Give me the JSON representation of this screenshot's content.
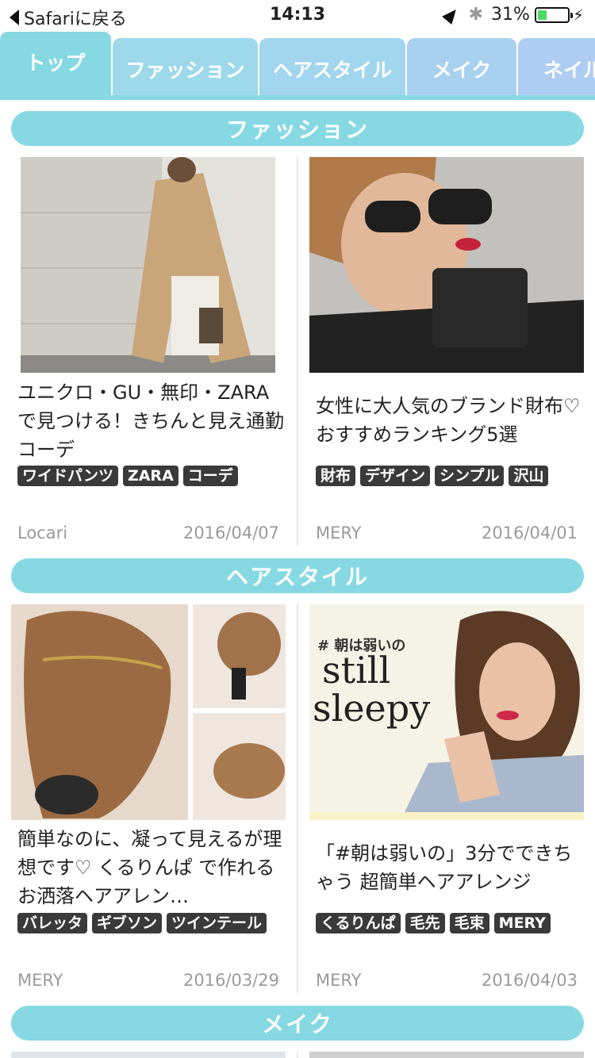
{
  "status_bar": {
    "back_label": "Safariに戻る",
    "time": "14:13",
    "battery_percent": "31%",
    "battery_level": 0.31
  },
  "tabs": [
    {
      "label": "トップ",
      "active": true
    },
    {
      "label": "ファッション"
    },
    {
      "label": "ヘアスタイル"
    },
    {
      "label": "メイク"
    },
    {
      "label": "ネイル"
    }
  ],
  "sections": [
    {
      "title": "ファッション",
      "cards": [
        {
          "title": "ユニクロ・GU・無印・ZARAで見つける！きちんと見え通勤コーデ",
          "tags": [
            "ワイドパンツ",
            "ZARA",
            "コーデ"
          ],
          "source": "Locari",
          "date": "2016/04/07"
        },
        {
          "title": "女性に大人気のブランド財布♡おすすめランキング5選",
          "tags": [
            "財布",
            "デザイン",
            "シンプル",
            "沢山"
          ],
          "source": "MERY",
          "date": "2016/04/01"
        }
      ]
    },
    {
      "title": "ヘアスタイル",
      "cards": [
        {
          "title": "簡単なのに、凝って見えるが理想です♡ くるりんぱ で作れるお洒落ヘアアレン…",
          "tags": [
            "バレッタ",
            "ギブソン",
            "ツインテール"
          ],
          "source": "MERY",
          "date": "2016/03/29"
        },
        {
          "title": "「#朝は弱いの」3分でできちゃう 超簡単ヘアアレンジ",
          "tags": [
            "くるりんぱ",
            "毛先",
            "毛束",
            "MERY"
          ],
          "source": "MERY",
          "date": "2016/04/03",
          "image_text": {
            "hashtag": "# 朝は弱いの",
            "line1": "still",
            "line2": "sleepy"
          }
        }
      ]
    },
    {
      "title": "メイク",
      "cards": []
    }
  ],
  "colors": {
    "accent": "#86d9e3",
    "tag_bg": "#3a3a3a",
    "meta_text": "#9a9a9a"
  }
}
